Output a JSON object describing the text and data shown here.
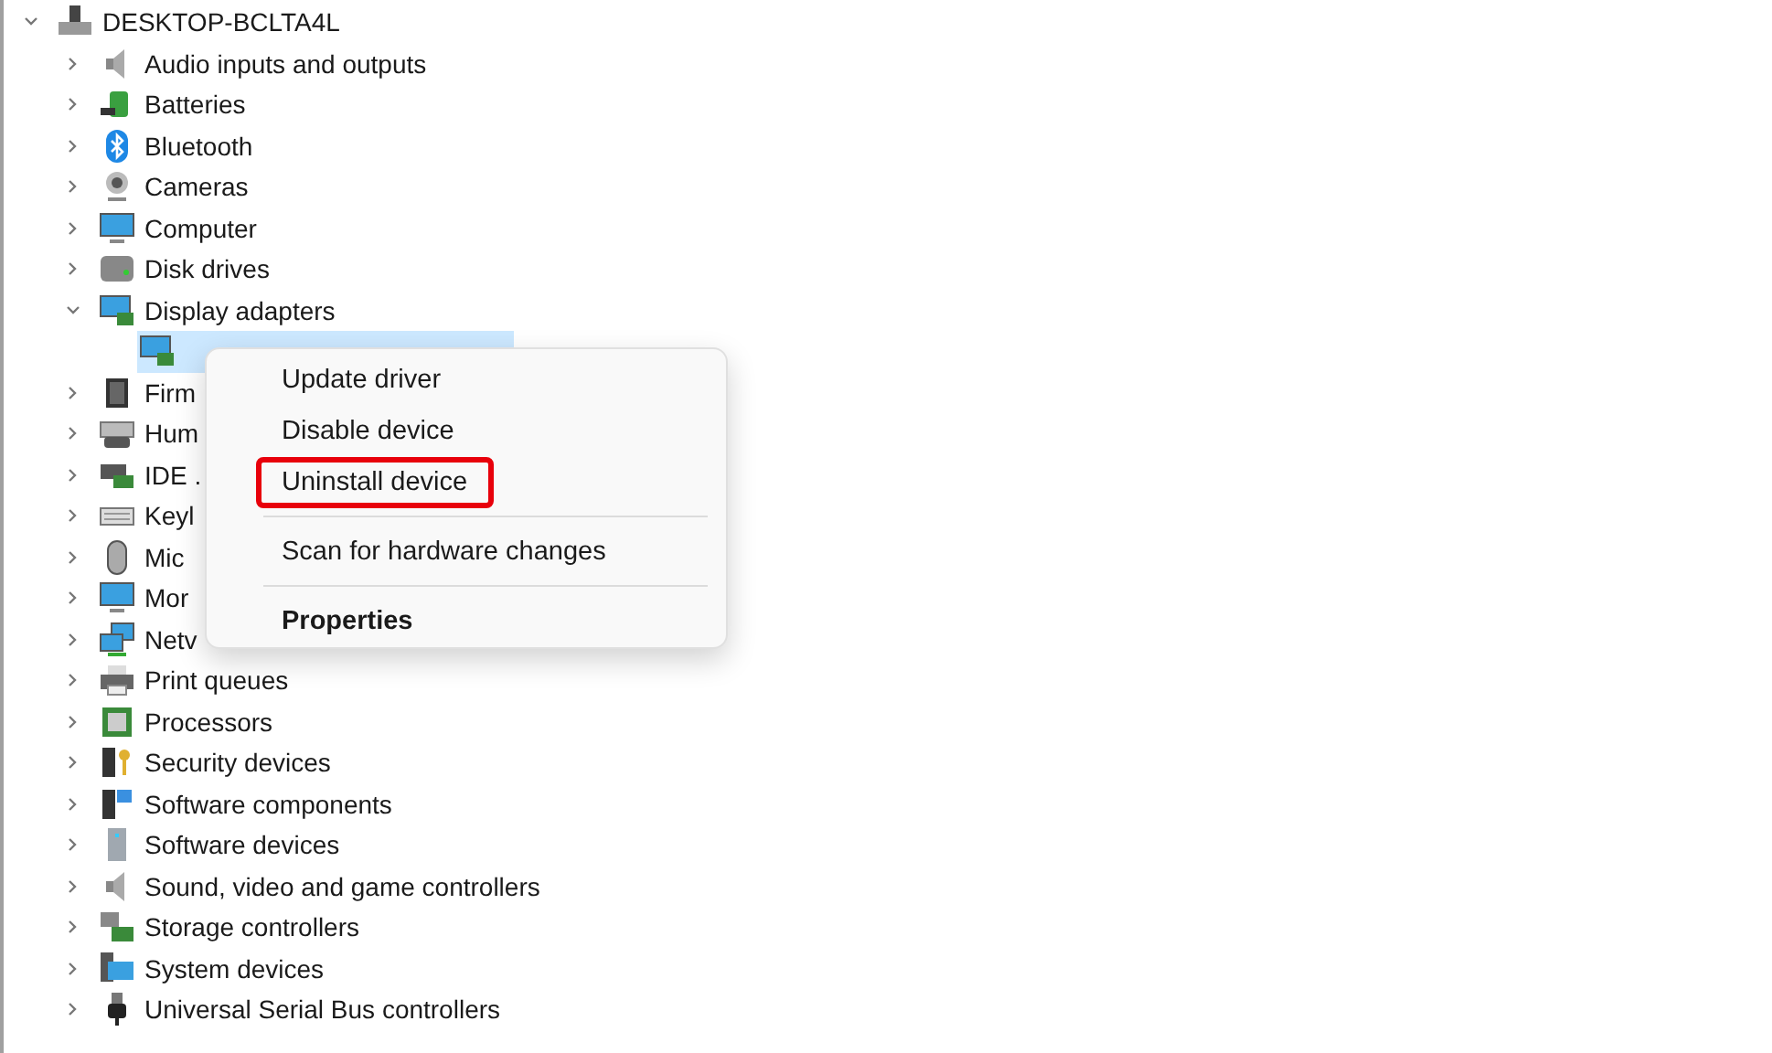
{
  "tree": {
    "label": "DESKTOP-BCLTA4L",
    "expanded": true,
    "selected": false,
    "children": [
      {
        "label": "Audio inputs and outputs",
        "expanded": false,
        "selected": false
      },
      {
        "label": "Batteries",
        "expanded": false,
        "selected": false
      },
      {
        "label": "Bluetooth",
        "expanded": false,
        "selected": false
      },
      {
        "label": "Cameras",
        "expanded": false,
        "selected": false
      },
      {
        "label": "Computer",
        "expanded": false,
        "selected": false
      },
      {
        "label": "Disk drives",
        "expanded": false,
        "selected": false
      },
      {
        "label": "Display adapters",
        "expanded": true,
        "selected": false,
        "children": [
          {
            "selected": true
          }
        ]
      },
      {
        "label": "Firm",
        "expanded": false,
        "selected": false
      },
      {
        "label": "Hum",
        "expanded": false,
        "selected": false
      },
      {
        "label": "IDE .",
        "expanded": false,
        "selected": false
      },
      {
        "label": "Keyl",
        "expanded": false,
        "selected": false
      },
      {
        "label": "Mic",
        "expanded": false,
        "selected": false
      },
      {
        "label": "Mor",
        "expanded": false,
        "selected": false
      },
      {
        "label": "Netv",
        "expanded": false,
        "selected": false
      },
      {
        "label": "Print queues",
        "expanded": false,
        "selected": false
      },
      {
        "label": "Processors",
        "expanded": false,
        "selected": false
      },
      {
        "label": "Security devices",
        "expanded": false,
        "selected": false
      },
      {
        "label": "Software components",
        "expanded": false,
        "selected": false
      },
      {
        "label": "Software devices",
        "expanded": false,
        "selected": false
      },
      {
        "label": "Sound, video and game controllers",
        "expanded": false,
        "selected": false
      },
      {
        "label": "Storage controllers",
        "expanded": false,
        "selected": false
      },
      {
        "label": "System devices",
        "expanded": false,
        "selected": false
      },
      {
        "label": "Universal Serial Bus controllers",
        "expanded": false,
        "selected": false
      }
    ]
  },
  "context_menu": [
    {
      "kind": "item",
      "label": "Update driver",
      "highlighted": false,
      "bold": false
    },
    {
      "kind": "item",
      "label": "Disable device",
      "highlighted": false,
      "bold": false
    },
    {
      "kind": "item",
      "label": "Uninstall device",
      "highlighted": true,
      "bold": false
    },
    {
      "kind": "separator"
    },
    {
      "kind": "item",
      "label": "Scan for hardware changes",
      "highlighted": false,
      "bold": false
    },
    {
      "kind": "separator"
    },
    {
      "kind": "item",
      "label": "Properties",
      "highlighted": false,
      "bold": true
    }
  ]
}
